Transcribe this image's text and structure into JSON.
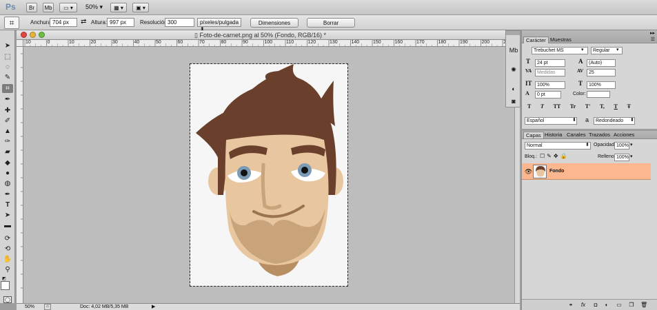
{
  "app": {
    "logo": "Ps",
    "bridge_label": "Br",
    "minibridge_label": "Mb",
    "zoom": "50%"
  },
  "options": {
    "width_label": "Anchura:",
    "width_value": "704 px",
    "height_label": "Altura:",
    "height_value": "997 px",
    "resolution_label": "Resolución:",
    "resolution_value": "300",
    "resolution_unit": "píxeles/pulgada",
    "dimensions_button": "Dimensiones",
    "clear_button": "Borrar"
  },
  "document": {
    "title": "Foto-de-carnet.png al 50% (Fondo, RGB/16) *",
    "ruler_ticks": [
      "10",
      "0",
      "10",
      "20",
      "30",
      "40",
      "50",
      "60",
      "70",
      "80",
      "90",
      "100",
      "110",
      "120",
      "130",
      "140",
      "150",
      "160",
      "170",
      "180",
      "190",
      "200",
      "210"
    ]
  },
  "status": {
    "zoom": "50%",
    "doc_info": "Doc: 4,02 MB/5,35 MB"
  },
  "character_panel": {
    "tab_character": "Carácter",
    "tab_samples": "Muestras",
    "font_family": "Trebuchet MS",
    "font_style": "Regular",
    "font_size": "24 pt",
    "leading": "(Auto)",
    "kerning": "Medidas",
    "tracking": "25",
    "vertical_scale": "100%",
    "horizontal_scale": "100%",
    "baseline_shift": "0 pt",
    "color_label": "Color:",
    "language": "Español",
    "antialias_label": "a",
    "antialias": "Redondeado",
    "type_buttons": [
      "T",
      "T",
      "TT",
      "Tr",
      "T'",
      "T,",
      "T",
      "Ŧ"
    ]
  },
  "layers_panel": {
    "tabs": [
      "Capas",
      "Historia",
      "Canales",
      "Trazados",
      "Acciones"
    ],
    "blend_mode": "Normal",
    "opacity_label": "Opacidad:",
    "opacity_value": "100%",
    "lock_label": "Bloq.:",
    "fill_label": "Relleno:",
    "fill_value": "100%",
    "layer_name": "Fondo"
  },
  "colors": {
    "hair": "#6a3f2b",
    "skin": "#e7c6a0",
    "beard": "#c9a47a",
    "neck": "#b88f63",
    "eye": "#7a9ab6",
    "layer_highlight": "#fdb78e"
  }
}
